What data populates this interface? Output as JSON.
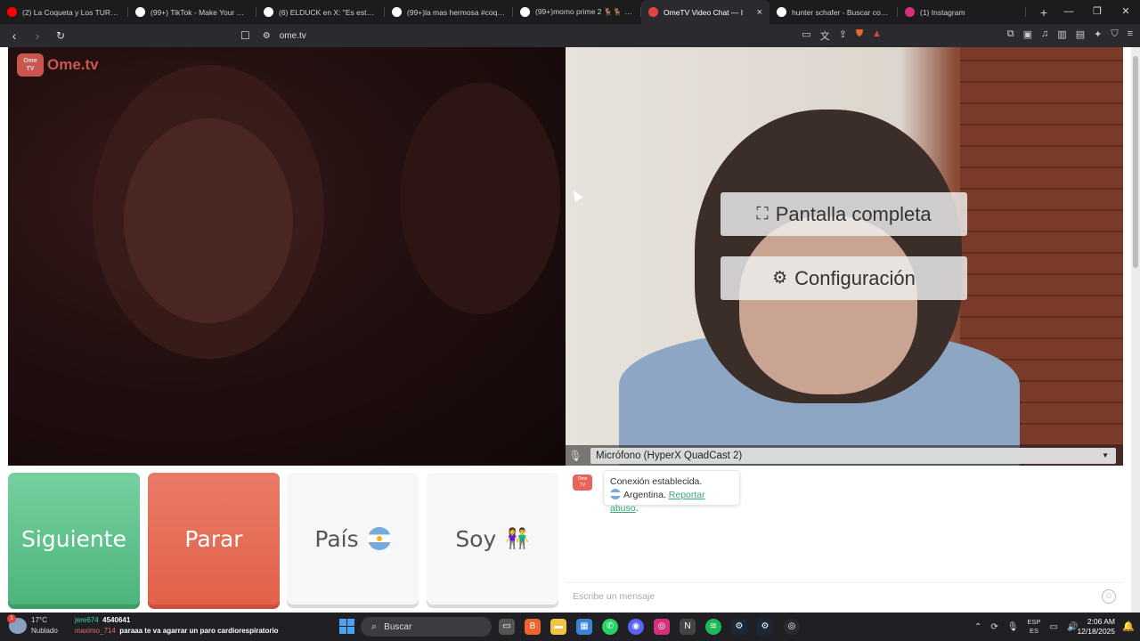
{
  "browser": {
    "tabs": [
      {
        "title": "(2) La Coqueta y Los TURROS e",
        "favicon": "youtube-icon",
        "color": "#ff0000"
      },
      {
        "title": "(99+) TikTok - Make Your Day",
        "favicon": "tiktok-icon",
        "color": "#ffffff"
      },
      {
        "title": "(6) ELDUCK en X: \"Es este? Kjah",
        "favicon": "x-icon",
        "color": "#ffffff"
      },
      {
        "title": "(99+)la mas hermosa #coqueta",
        "favicon": "tiktok-icon",
        "color": "#ffffff"
      },
      {
        "title": "(99+)momo prime 2 🦌🦌 #fc",
        "favicon": "tiktok-icon",
        "color": "#ffffff"
      },
      {
        "title": "OmeTV Video Chat — I",
        "favicon": "record-icon",
        "color": "#e04545",
        "active": true
      },
      {
        "title": "hunter schafer - Buscar con Go",
        "favicon": "google-icon",
        "color": "#ffffff"
      },
      {
        "title": "(1) Instagram",
        "favicon": "instagram-icon",
        "color": "#d6307a"
      }
    ],
    "new_tab": "+",
    "url": "ome.tv",
    "window_controls": [
      "—",
      "❐",
      "✕"
    ]
  },
  "remote": {
    "logo_top": "Ome",
    "logo_bottom": "TV",
    "logo_text": "Ome.tv"
  },
  "local": {
    "fullscreen_label": "Pantalla completa",
    "settings_label": "Configuración",
    "microphone": "Micrófono (HyperX QuadCast 2)"
  },
  "controls": {
    "next": "Siguiente",
    "stop": "Parar",
    "country": "País",
    "gender": "Soy",
    "gender_emoji": "👫"
  },
  "chat": {
    "line1": "Conexión establecida.",
    "country": "Argentina.",
    "report_link": "Reportar abuso",
    "report_suffix": ".",
    "placeholder": "Escribe un mensaje"
  },
  "taskbar": {
    "temp": "17°C",
    "condition": "Nublado",
    "weather_badge": "1",
    "chat_user1": "jere674",
    "chat_count": "4540641",
    "chat_user2": "maximo_714",
    "chat_message": "paraaa te va agarrar un paro cardiorespiratorio",
    "search": "Buscar",
    "lang_top": "ESP",
    "lang_bottom": "ES",
    "time": "2:06 AM",
    "date": "12/18/2025"
  }
}
